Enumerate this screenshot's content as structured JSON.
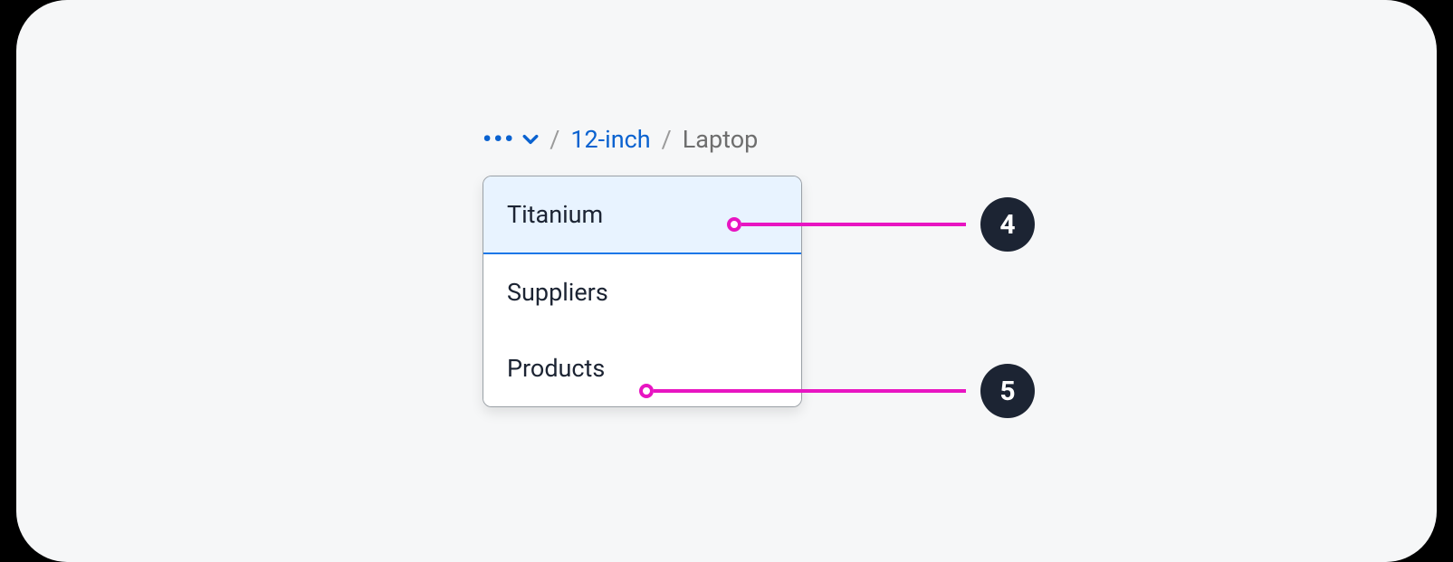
{
  "breadcrumb": {
    "overflow_symbol": "•••",
    "separator": "/",
    "link": "12-inch",
    "current": "Laptop"
  },
  "dropdown": {
    "items": [
      {
        "label": "Titanium",
        "highlight": true
      },
      {
        "label": "Suppliers",
        "highlight": false
      },
      {
        "label": "Products",
        "highlight": false
      }
    ]
  },
  "callouts": {
    "a": "4",
    "b": "5"
  },
  "colors": {
    "accent_blue": "#0a62d0",
    "callout_pink": "#e815c2",
    "badge_dark": "#1c2433",
    "highlight_bg": "#e8f3ff"
  }
}
